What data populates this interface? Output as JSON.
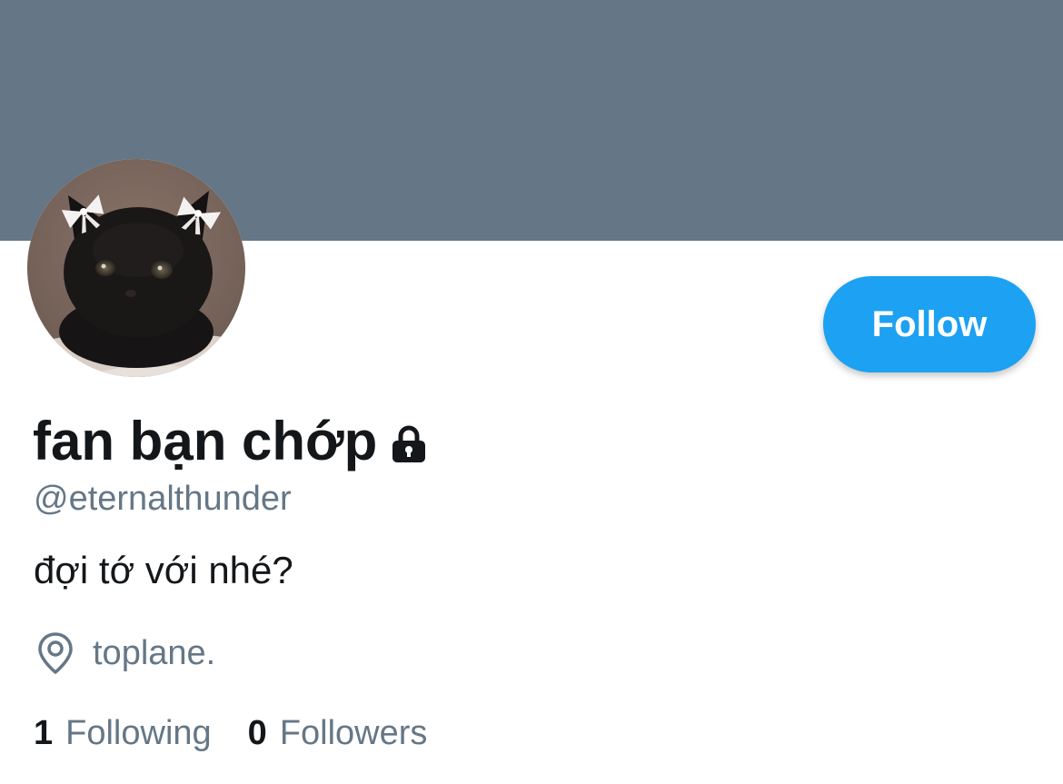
{
  "profile": {
    "display_name": "fan bạn chớp",
    "handle": "@eternalthunder",
    "bio": "đợi tớ với nhé?",
    "location": "toplane.",
    "protected": true,
    "avatar_icon": "black-kitten-with-white-bows",
    "lock_icon": "lock-icon",
    "location_icon": "location-pin-icon"
  },
  "actions": {
    "follow_label": "Follow"
  },
  "stats": {
    "following_count": "1",
    "following_label": "Following",
    "followers_count": "0",
    "followers_label": "Followers"
  },
  "colors": {
    "banner": "#657786",
    "accent": "#1da1f2",
    "primary_text": "#14171a",
    "secondary_text": "#657786"
  }
}
